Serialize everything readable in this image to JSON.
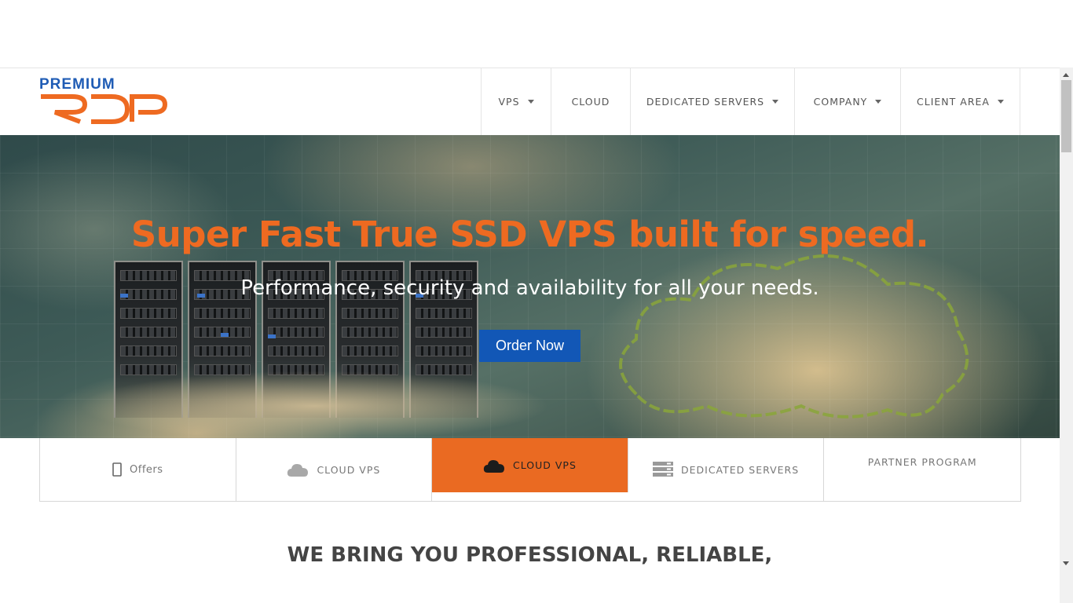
{
  "logo": {
    "line1": "PREMIUM",
    "line2": "RDP"
  },
  "nav": {
    "items": [
      {
        "label": "VPS",
        "dropdown": true
      },
      {
        "label": "CLOUD",
        "dropdown": false
      },
      {
        "label": "DEDICATED SERVERS",
        "dropdown": true
      },
      {
        "label": "COMPANY",
        "dropdown": true
      },
      {
        "label": "CLIENT AREA",
        "dropdown": true
      }
    ]
  },
  "hero": {
    "title": "Super Fast True SSD VPS built for speed.",
    "subtitle": "Performance, security and availability for all your needs.",
    "cta": "Order Now"
  },
  "tabs": [
    {
      "label": "Offers",
      "icon": "mobile-icon",
      "active": false
    },
    {
      "label": "CLOUD VPS",
      "icon": "cloud-icon",
      "active": false
    },
    {
      "label": "CLOUD VPS",
      "icon": "cloud-icon",
      "active": true
    },
    {
      "label": "DEDICATED SERVERS",
      "icon": "server-icon",
      "active": false
    },
    {
      "label": "PARTNER PROGRAM",
      "icon": "",
      "active": false
    }
  ],
  "section": {
    "headline": "WE BRING YOU PROFESSIONAL, RELIABLE,"
  },
  "colors": {
    "accent": "#ea6a22",
    "brand_blue": "#1257b6",
    "hero_title": "#ee6a21"
  }
}
